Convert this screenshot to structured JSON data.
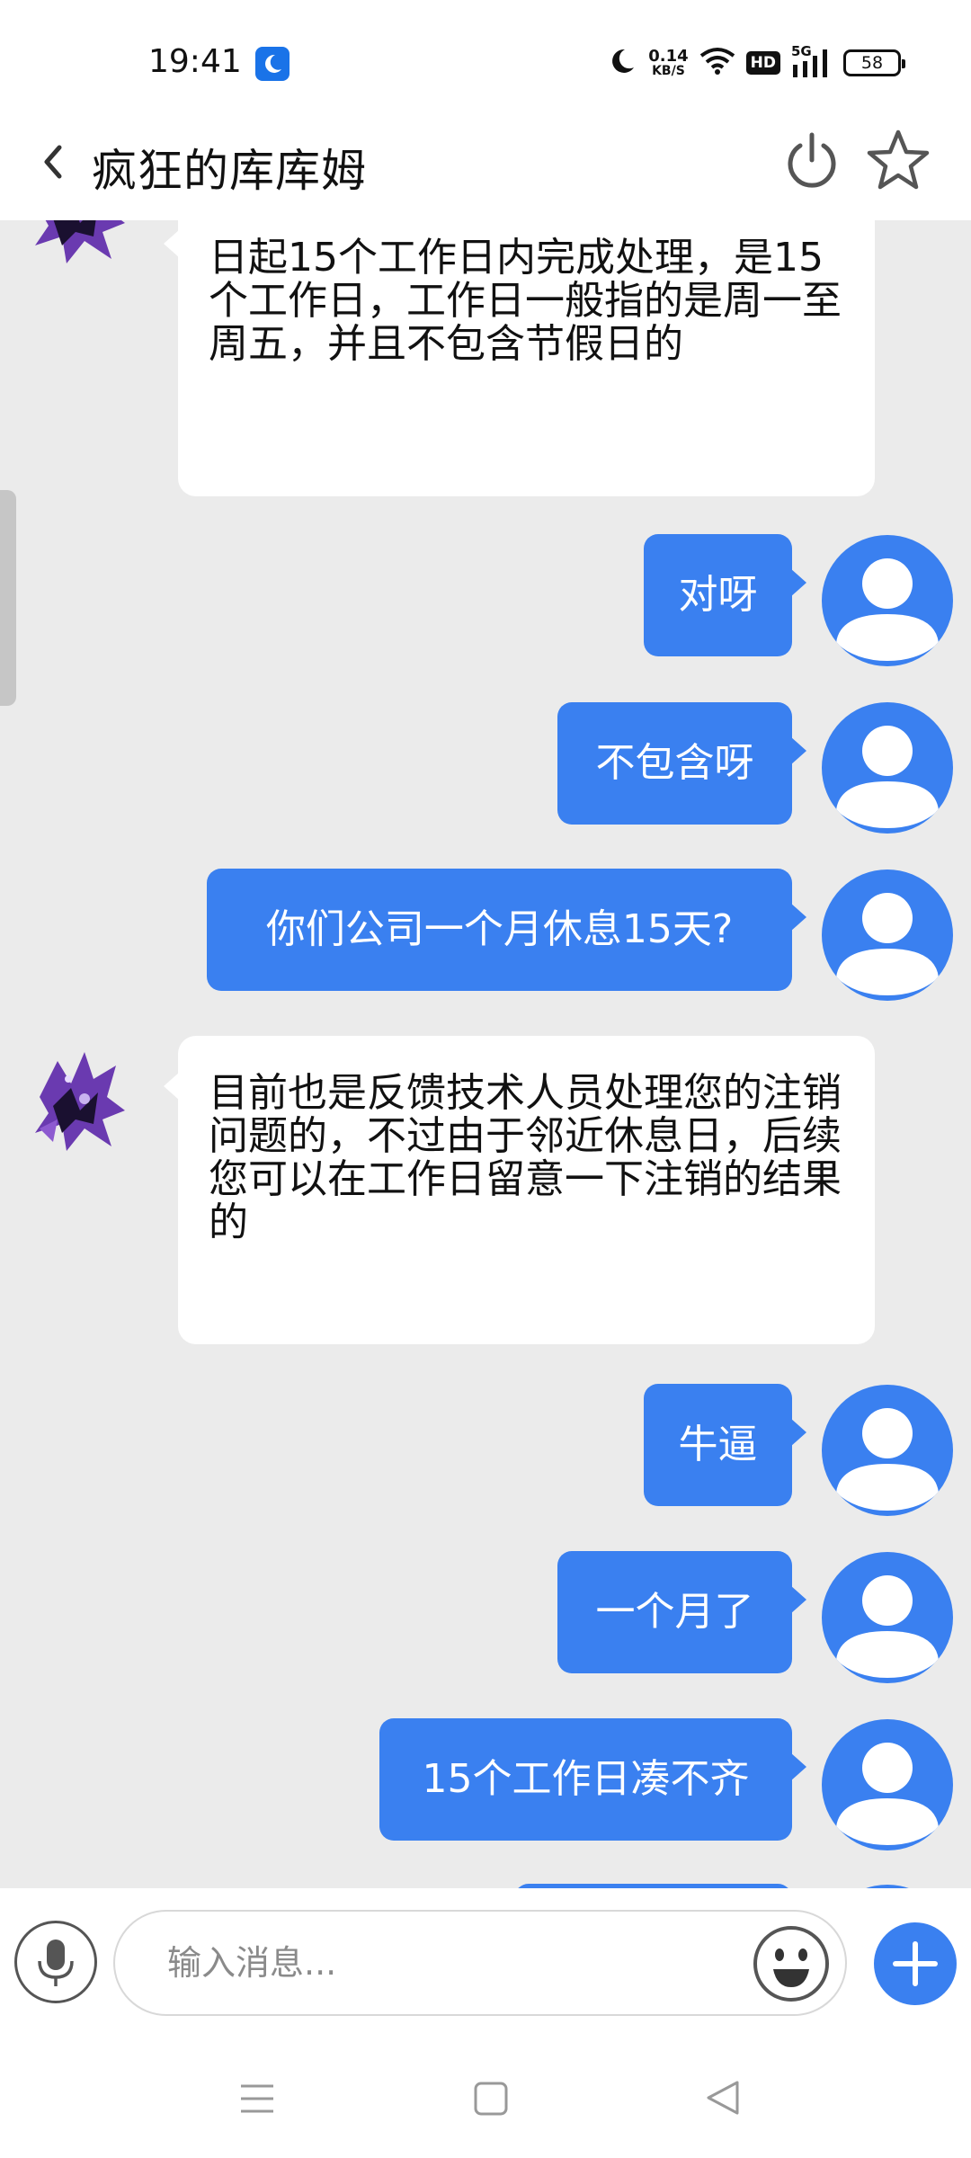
{
  "status_bar": {
    "time": "19:41",
    "net_speed_value": "0.14",
    "net_speed_unit": "KB/S",
    "hd_label": "HD",
    "signal_label": "5G",
    "battery_level": "58"
  },
  "header": {
    "title": "疯狂的库库姆"
  },
  "messages": [
    {
      "side": "in",
      "text": "日起15个工作日内完成处理，是15个工作日，工作日一般指的是周一至周五，并且不包含节假日的"
    },
    {
      "side": "out",
      "text": "对呀"
    },
    {
      "side": "out",
      "text": "不包含呀"
    },
    {
      "side": "out",
      "text": "你们公司一个月休息15天?"
    },
    {
      "side": "in",
      "text": "目前也是反馈技术人员处理您的注销问题的，不过由于邻近休息日，后续您可以在工作日留意一下注销的结果的"
    },
    {
      "side": "out",
      "text": "牛逼"
    },
    {
      "side": "out",
      "text": "一个月了"
    },
    {
      "side": "out",
      "text": "15个工作日凑不齐"
    }
  ],
  "input": {
    "placeholder": "输入消息..."
  },
  "colors": {
    "accent": "#3a80f0",
    "chat_background": "#ebebeb",
    "bubble_in": "#ffffff"
  },
  "icons": {
    "back": "chevron-left-icon",
    "power": "power-icon",
    "star": "star-icon",
    "mic": "microphone-icon",
    "emoji": "smiley-icon",
    "plus": "plus-icon",
    "nav_menu": "menu-icon",
    "nav_home": "square-home-icon",
    "nav_back": "triangle-back-icon"
  }
}
